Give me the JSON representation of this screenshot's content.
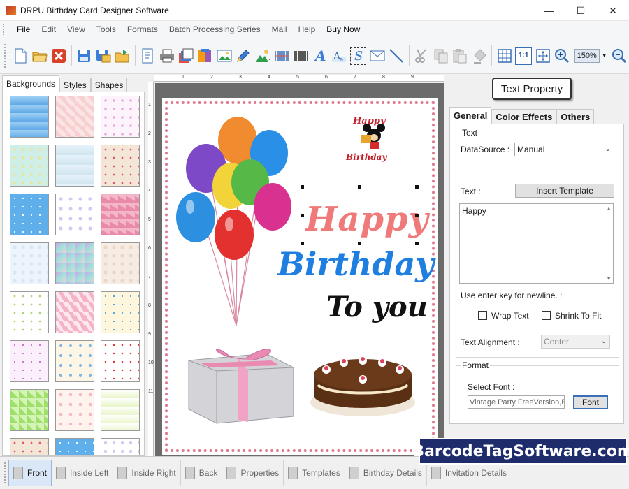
{
  "window": {
    "title": "DRPU Birthday Card Designer Software",
    "minimize": "—",
    "maximize": "☐",
    "close": "✕"
  },
  "menu": [
    "File",
    "Edit",
    "View",
    "Tools",
    "Formats",
    "Batch Processing Series",
    "Mail",
    "Help",
    "Buy Now"
  ],
  "toolbar": {
    "zoom_value": "150%",
    "ratio_label": "1:1"
  },
  "left_panel": {
    "tabs": [
      "Backgrounds",
      "Styles",
      "Shapes"
    ],
    "thumbnail_count": 21
  },
  "ruler": {
    "top_ticks": [
      "1",
      "2",
      "3",
      "4",
      "5",
      "6",
      "7",
      "8",
      "9"
    ],
    "left_ticks": [
      "1",
      "2",
      "3",
      "4",
      "5",
      "6",
      "7",
      "8",
      "9",
      "10",
      "11"
    ]
  },
  "card": {
    "sticker_line1": "Happy",
    "sticker_line2": "Birthday",
    "line1": "Happy",
    "line2": "Birthday",
    "line3": "To you"
  },
  "right_panel": {
    "title": "Text Property",
    "tabs": [
      "General",
      "Color Effects",
      "Others"
    ],
    "text_group_label": "Text",
    "datasource_label": "DataSource :",
    "datasource_value": "Manual",
    "text_label": "Text :",
    "insert_template_btn": "Insert Template",
    "text_value": "Happy",
    "newline_hint": "Use enter key for newline. :",
    "wrap_text": "Wrap Text",
    "shrink_to_fit": "Shrink To Fit",
    "alignment_label": "Text Alignment :",
    "alignment_value": "Center",
    "format_group_label": "Format",
    "select_font_label": "Select Font :",
    "font_value": "Vintage Party FreeVersion,Bo",
    "font_btn": "Font"
  },
  "bottom_tabs": [
    "Front",
    "Inside Left",
    "Inside Right",
    "Back",
    "Properties",
    "Templates",
    "Birthday Details",
    "Invitation Details"
  ],
  "watermark": "BarcodeTagSoftware.com"
}
